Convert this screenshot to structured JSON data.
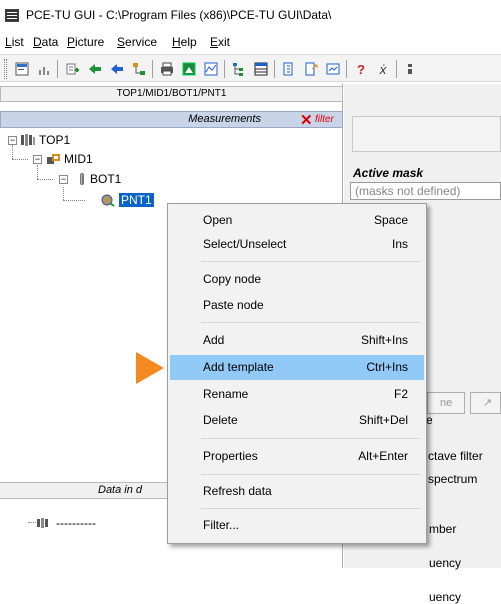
{
  "window": {
    "title": "PCE-TU GUI - C:\\Program Files (x86)\\PCE-TU GUI\\Data\\"
  },
  "menubar": [
    {
      "label": "List",
      "underline": "L"
    },
    {
      "label": "Data",
      "underline": "D"
    },
    {
      "label": "Picture",
      "underline": "P"
    },
    {
      "label": "Service",
      "underline": "S"
    },
    {
      "label": "Help",
      "underline": "H"
    },
    {
      "label": "Exit",
      "underline": "E"
    }
  ],
  "toolbar": {
    "icons": [
      "properties-icon",
      "chart-icon",
      "list-add-icon",
      "green-arrow-left-icon",
      "blue-arrow-icon",
      "diagram-icon",
      "print-icon",
      "image-icon",
      "graph-icon",
      "tree-icon",
      "table-icon",
      "import-icon",
      "export-icon",
      "window-icon",
      "help-icon",
      "context-help-icon",
      "extra-icon"
    ]
  },
  "left_panel": {
    "path": "TOP1/MID1/BOT1/PNT1",
    "header": "Measurements",
    "filter_label": "filter",
    "tree": [
      {
        "label": "TOP1",
        "level": 0,
        "icon": "top-level-icon"
      },
      {
        "label": "MID1",
        "level": 1,
        "icon": "mid-level-icon"
      },
      {
        "label": "BOT1",
        "level": 2,
        "icon": "bottom-level-icon"
      },
      {
        "label": "PNT1",
        "level": 3,
        "icon": "point-icon",
        "selected": true
      }
    ],
    "data_header": "Data in d",
    "data_row_label": "----------"
  },
  "right_panel": {
    "active_mask_label": "Active mask",
    "masks_placeholder": "(masks not defined)",
    "button_1_text": "ne",
    "button_2_text": "↗",
    "text_e": "e",
    "octave_filter": "ctave filter",
    "spectrum": "spectrum",
    "number": "mber",
    "frequency_1": "uency",
    "frequency_2": "uency"
  },
  "context_menu": {
    "items": [
      {
        "label": "Open",
        "shortcut": "Space"
      },
      {
        "label": "Select/Unselect",
        "shortcut": "Ins"
      },
      {
        "label": "Copy node",
        "shortcut": ""
      },
      {
        "label": "Paste node",
        "shortcut": ""
      },
      {
        "label": "Add",
        "shortcut": "Shift+Ins"
      },
      {
        "label": "Add template",
        "shortcut": "Ctrl+Ins",
        "highlighted": true
      },
      {
        "label": "Rename",
        "shortcut": "F2"
      },
      {
        "label": "Delete",
        "shortcut": "Shift+Del"
      },
      {
        "label": "Properties",
        "shortcut": "Alt+Enter"
      },
      {
        "label": "Refresh data",
        "shortcut": ""
      },
      {
        "label": "Filter...",
        "shortcut": ""
      }
    ]
  },
  "colors": {
    "selection": "#0a64c8",
    "menu_highlight": "#91c9f7",
    "header_band": "#c9d4e8",
    "filter_red": "#dd0000",
    "arrow_orange": "#f5891f"
  }
}
